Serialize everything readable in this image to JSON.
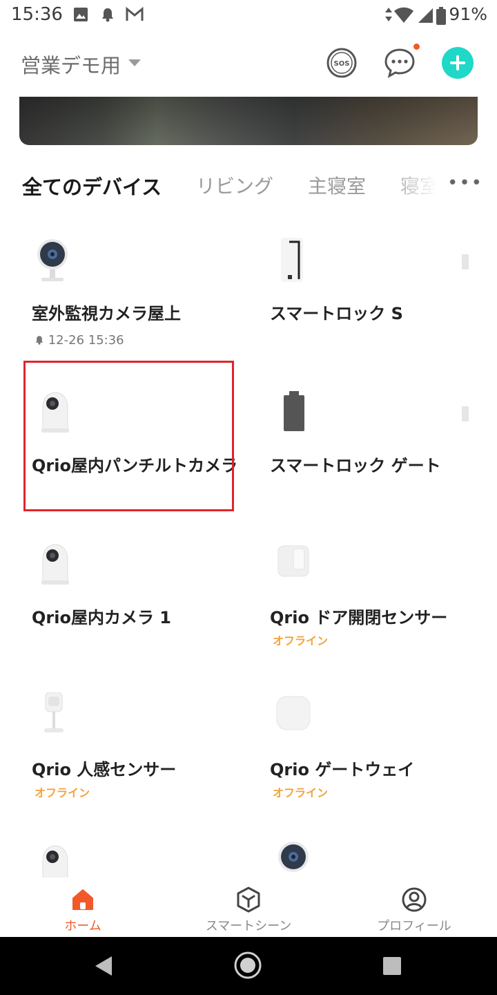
{
  "status_bar": {
    "time": "15:36",
    "battery": "91%"
  },
  "header": {
    "home_name": "営業デモ用"
  },
  "tabs": [
    {
      "label": "全てのデバイス",
      "active": true
    },
    {
      "label": "リビング",
      "active": false
    },
    {
      "label": "主寝室",
      "active": false
    },
    {
      "label": "寝室",
      "active": false
    }
  ],
  "tabs_more": "•••",
  "devices": [
    {
      "name": "室外監視カメラ屋上",
      "sub": "12-26 15:36",
      "icon": "camera-ball-icon"
    },
    {
      "name": "スマートロック S",
      "icon": "smart-lock-icon"
    },
    {
      "name": "Qrio屋内パンチルトカメラ",
      "icon": "pan-tilt-camera-icon"
    },
    {
      "name": "スマートロック ゲート",
      "icon": "battery-device-icon"
    },
    {
      "name": "Qrio屋内カメラ 1",
      "icon": "pan-tilt-camera-icon"
    },
    {
      "name": "Qrio ドア開閉センサー",
      "status": "オフライン",
      "icon": "door-sensor-icon"
    },
    {
      "name": "Qrio 人感センサー",
      "status": "オフライン",
      "icon": "motion-sensor-icon"
    },
    {
      "name": "Qrio ゲートウェイ",
      "status": "オフライン",
      "icon": "gateway-icon"
    },
    {
      "name": "",
      "icon": "pan-tilt-camera-icon"
    },
    {
      "name": "",
      "icon": "camera-ball-icon"
    }
  ],
  "bottom_nav": [
    {
      "label": "ホーム",
      "active": true
    },
    {
      "label": "スマートシーン",
      "active": false
    },
    {
      "label": "プロフィール",
      "active": false
    }
  ],
  "colors": {
    "accent": "#f2592a",
    "add_button": "#1fd8c8",
    "highlight": "#e0242c",
    "status_offline": "#f2a33a"
  }
}
